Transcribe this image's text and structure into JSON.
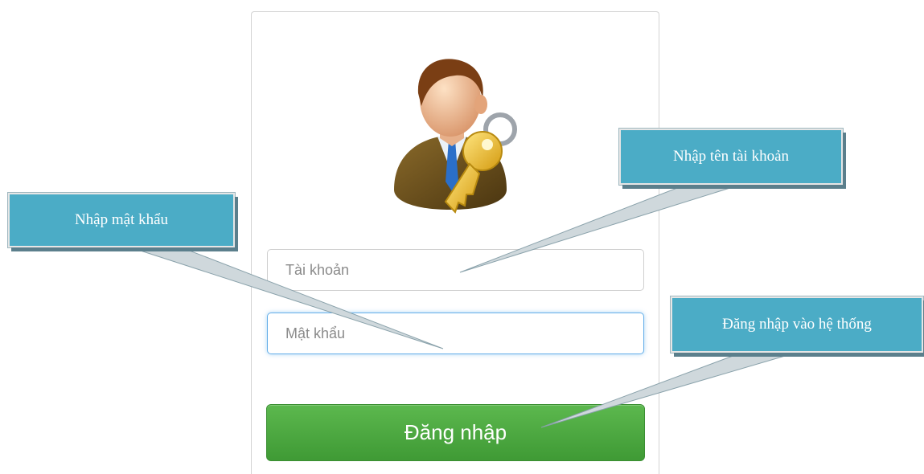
{
  "form": {
    "username_placeholder": "Tài khoản",
    "password_placeholder": "Mật khẩu",
    "login_label": "Đăng nhập"
  },
  "callouts": {
    "account": "Nhập tên tài khoản",
    "password": "Nhập mật khẩu",
    "login": "Đăng nhập vào hệ thống"
  },
  "icons": {
    "avatar": "user-with-key-icon"
  },
  "colors": {
    "callout": "#4bacc6",
    "button": "#4ba541",
    "focus_border": "#66afe9"
  }
}
